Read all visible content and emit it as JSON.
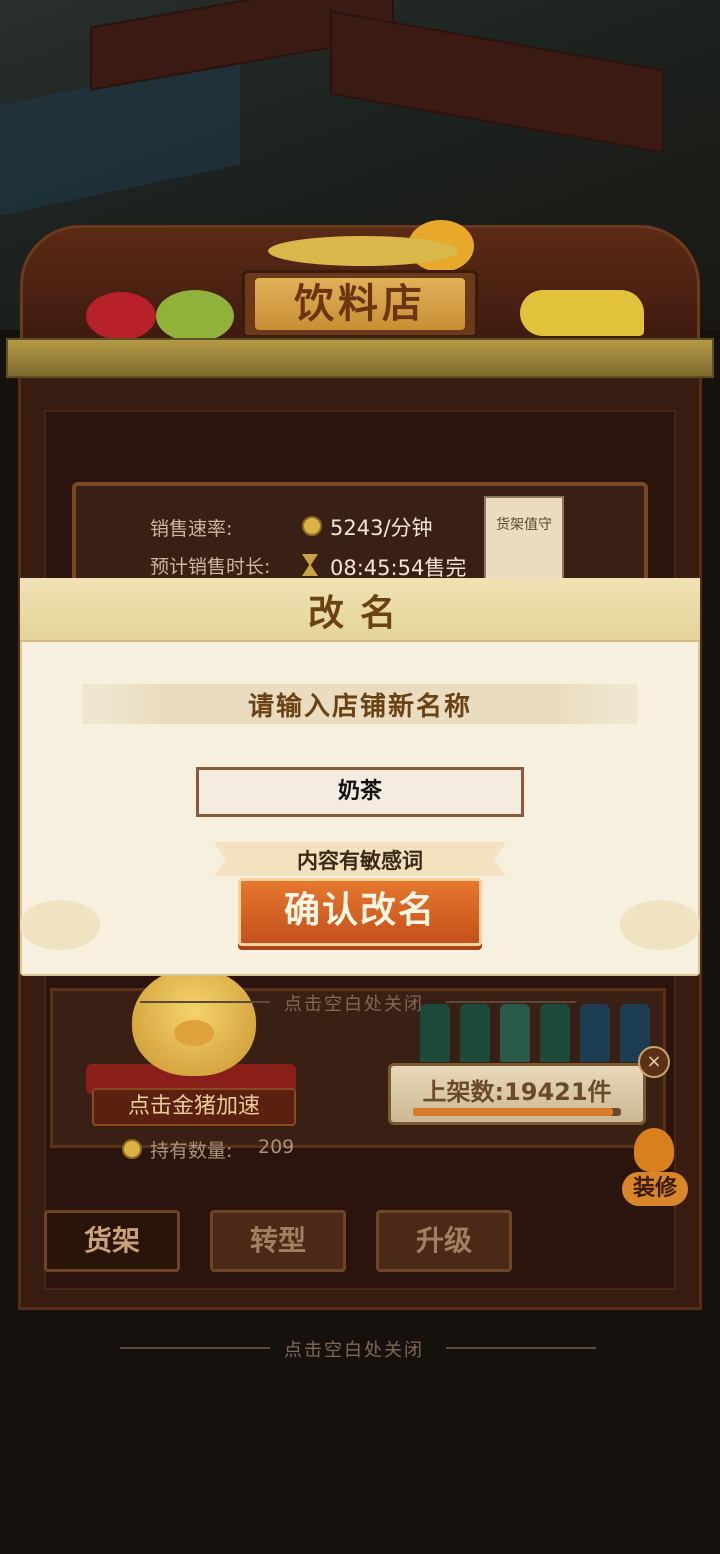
{
  "shop": {
    "name": "饮料店",
    "sales_rate_label": "销售速率:",
    "sales_rate_value": "5243/分钟",
    "sales_time_label": "预计销售时长:",
    "sales_time_value": "08:45:54售完",
    "shelf_guard_tag": "货架值守",
    "pig_button": "点击金猪加速",
    "hold_count_label": "持有数量:",
    "hold_count_value": "209",
    "on_shelf_text": "上架数:19421件",
    "on_shelf_progress": 0.96,
    "decor_button": "装修",
    "close_icon": "×",
    "tabs": [
      {
        "label": "货架",
        "active": true
      },
      {
        "label": "转型",
        "active": false
      },
      {
        "label": "升级",
        "active": false
      }
    ],
    "dismiss_hint_top": "点击空白处关闭",
    "dismiss_hint_bottom": "点击空白处关闭"
  },
  "rename_dialog": {
    "title": "改名",
    "prompt": "请输入店铺新名称",
    "input_value": "奶茶",
    "warning": "内容有敏感词",
    "confirm_button": "确认改名"
  },
  "colors": {
    "accent_orange": "#d9682a",
    "dialog_bg": "#f7f0de",
    "title_brown": "#6b4214"
  }
}
